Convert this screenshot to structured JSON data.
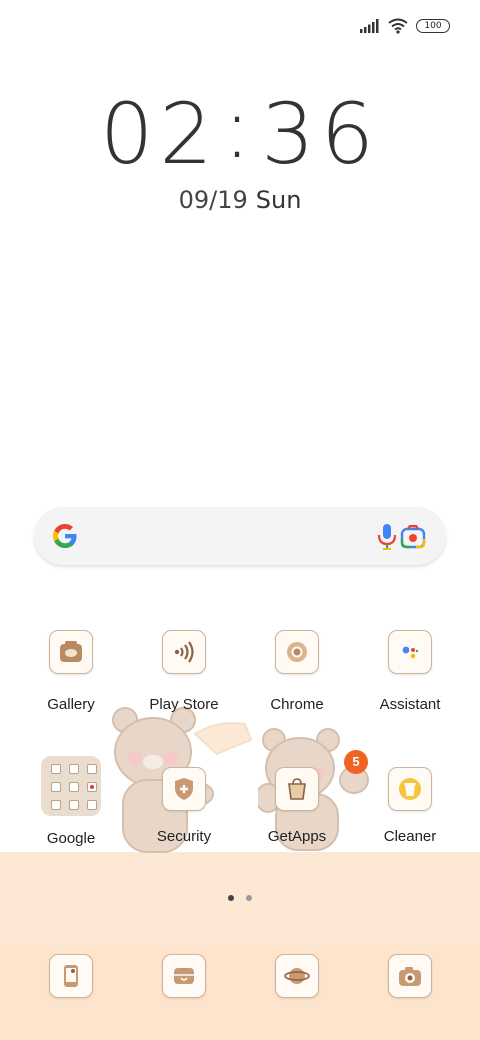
{
  "status_bar": {
    "battery": "100",
    "icons": [
      "signal-icon",
      "wifi-icon",
      "battery-icon"
    ]
  },
  "lock_clock": {
    "hour": "02",
    "minute": "36",
    "date": "09/19",
    "weekday": "Sun"
  },
  "search_bar": {
    "icons": [
      "google-logo",
      "microphone-icon",
      "google-lens-icon"
    ]
  },
  "apps_row1": [
    {
      "label": "Gallery",
      "icon": "gallery-icon"
    },
    {
      "label": "Play Store",
      "icon": "play-store-icon"
    },
    {
      "label": "Chrome",
      "icon": "chrome-icon"
    },
    {
      "label": "Assistant",
      "icon": "assistant-icon"
    }
  ],
  "apps_row2": [
    {
      "label": "Google",
      "icon": "google-folder"
    },
    {
      "label": "Security",
      "icon": "security-icon"
    },
    {
      "label": "GetApps",
      "icon": "getapps-icon",
      "badge": "5"
    },
    {
      "label": "Cleaner",
      "icon": "cleaner-icon"
    }
  ],
  "page_indicator": {
    "pages": 2,
    "active": 1
  },
  "dock": [
    {
      "icon": "phone-icon"
    },
    {
      "icon": "messages-icon"
    },
    {
      "icon": "browser-icon"
    },
    {
      "icon": "camera-icon"
    }
  ],
  "colors": {
    "accent_badge": "#f16322",
    "band_light": "#fce8d4",
    "band_dark": "#fde4cc",
    "tile_bg": "#fffaf4"
  }
}
